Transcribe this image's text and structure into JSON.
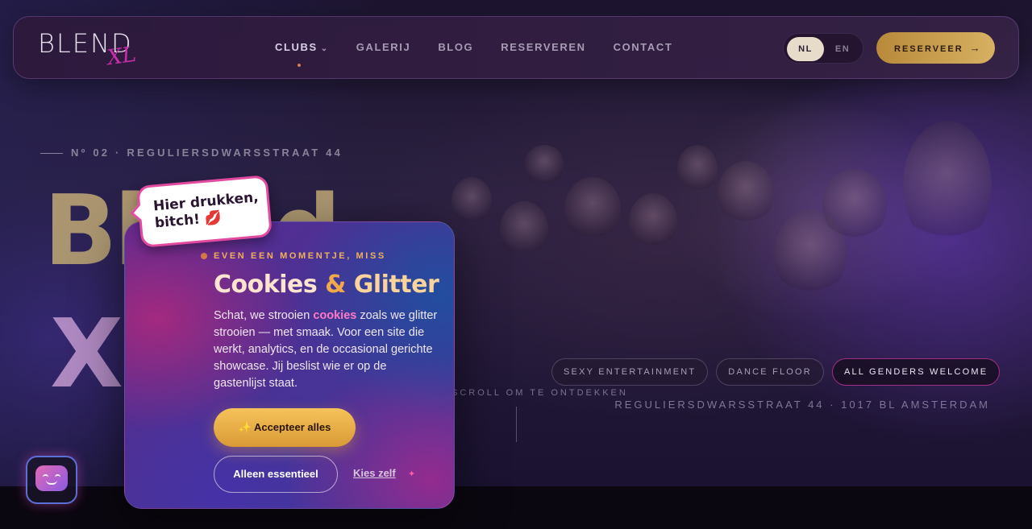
{
  "brand": {
    "logo_main": "BLEND",
    "logo_sub": "XL"
  },
  "nav": {
    "items": [
      {
        "label": "CLUBS"
      },
      {
        "label": "GALERIJ"
      },
      {
        "label": "BLOG"
      },
      {
        "label": "RESERVEREN"
      },
      {
        "label": "CONTACT"
      }
    ],
    "lang_nl": "NL",
    "lang_en": "EN",
    "cta_label": "RESERVEER",
    "cta_arrow": "→"
  },
  "hero": {
    "eyebrow": "Nº 02 · REGULIERSDWARSSTRAAT 44",
    "title": "Blend",
    "title_line2": "X",
    "scroll_hint": "SCROLL OM TE ONTDEKKEN",
    "tags": [
      "SEXY ENTERTAINMENT",
      "DANCE FLOOR",
      "ALL GENDERS WELCOME"
    ],
    "address": "REGULIERSDWARSSTRAAT 44 · 1017 BL AMSTERDAM"
  },
  "cookie": {
    "bubble_line1": "Hier drukken,",
    "bubble_line2": "bitch! 💋",
    "eyebrow": "EVEN EEN MOMENTJE, MISS",
    "title_a": "Cookies ",
    "title_amp": "&",
    "title_b": " Glitter",
    "body_pre": "Schat, we strooien ",
    "body_highlight": "cookies",
    "body_post": " zoals we glitter strooien — met smaak. Voor een site die werkt, analytics, en de occasional gerichte showcase. Jij beslist wie er op de gastenlijst staat.",
    "accept_label": "✨ Accepteer alles",
    "essential_label": "Alleen essentieel",
    "choose_label": "Kies zelf",
    "sparkle": "✦"
  },
  "colors": {
    "accent_gold": "#d7b062",
    "accent_pink": "#e24aa0"
  },
  "icons": {
    "menu_chevron": "chevron-down-icon",
    "chat_bot": "chat-bot-icon"
  }
}
